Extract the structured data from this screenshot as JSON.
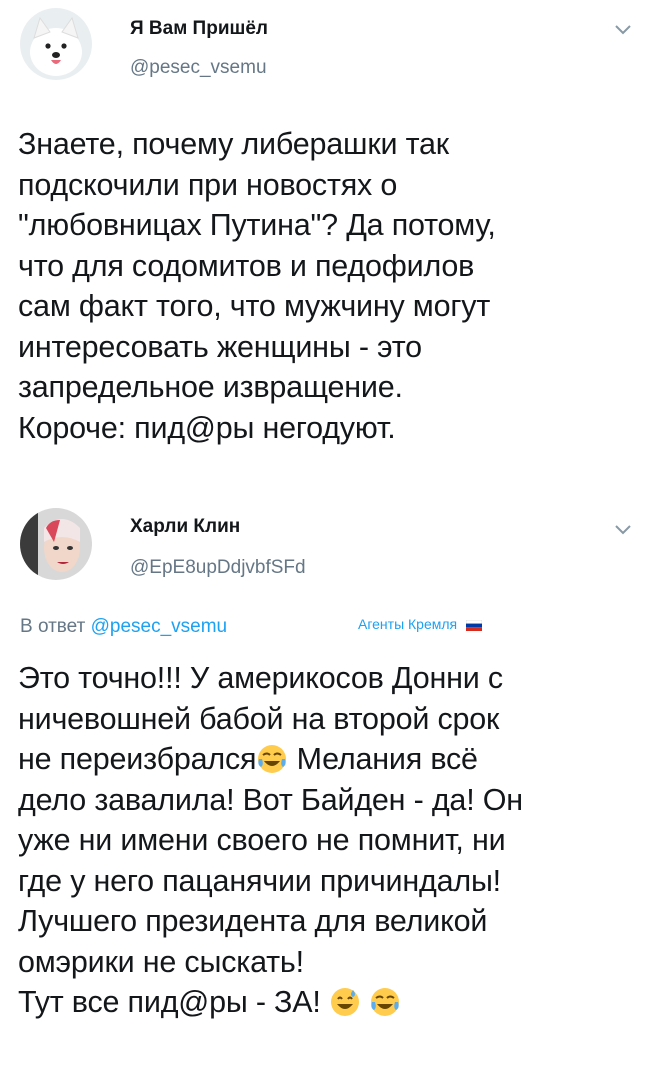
{
  "tweet1": {
    "author_name": "Я Вам Пришёл",
    "author_handle": "@pesec_vsemu",
    "avatar_icon": "white-dog-avatar",
    "body": "Знаете, почему либерашки так\nподскочили при новостях о\n\"любовницах Путина\"? Да потому,\nчто для содомитов и педофилов\nсам факт того, что мужчину могут\nинтересовать женщины - это\nзапредельное извращение.\nКороче: пид@ры негодуют."
  },
  "tweet2": {
    "author_name": "Харли Клин",
    "author_handle": "@EpE8upDdjvbfSFd",
    "avatar_icon": "harley-quinn-avatar",
    "reply_prefix": "В ответ",
    "reply_to": "@pesec_vsemu",
    "badge_label": "Агенты Кремля",
    "body_line1": "Это точно!!! У америкосов Донни с\nничевошней бабой на второй срок\nне переизбрался",
    "body_line2": " Мелания всё\nдело завалила! Вот Байден - да! Он\nуже ни имени своего не помнит, ни\nгде у него пацанячии причиндалы!\nЛучшего президента для великой\nомэрики не сыскать!\nТут все пид@ры - ЗА! "
  },
  "colors": {
    "text": "#14171a",
    "secondary": "#657786",
    "link": "#1da1f2"
  }
}
